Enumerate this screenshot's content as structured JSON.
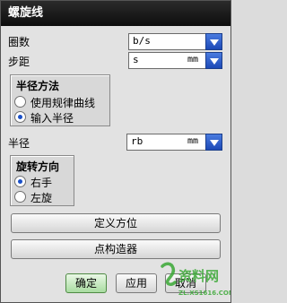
{
  "window": {
    "title": "螺旋线"
  },
  "turns": {
    "label": "圈数",
    "value": "b/s"
  },
  "pitch": {
    "label": "步距",
    "value": "s",
    "unit": "mm"
  },
  "radius_method": {
    "title": "半径方法",
    "options": [
      {
        "label": "使用规律曲线",
        "selected": false
      },
      {
        "label": "输入半径",
        "selected": true
      }
    ]
  },
  "radius": {
    "label": "半径",
    "value": "rb",
    "unit": "mm"
  },
  "rotation": {
    "title": "旋转方向",
    "options": [
      {
        "label": "右手",
        "selected": true
      },
      {
        "label": "左旋",
        "selected": false
      }
    ]
  },
  "buttons": {
    "define_orientation": "定义方位",
    "point_constructor": "点构造器",
    "ok": "确定",
    "apply": "应用",
    "cancel": "取消"
  },
  "watermark": {
    "brand": "资料网",
    "url": "ZL.XS1616.COM"
  },
  "colors": {
    "title_bg": "#1a1a1a",
    "accent": "#1a50c8",
    "ok_green": "#a8dca0",
    "watermark_green": "#3aa835"
  }
}
